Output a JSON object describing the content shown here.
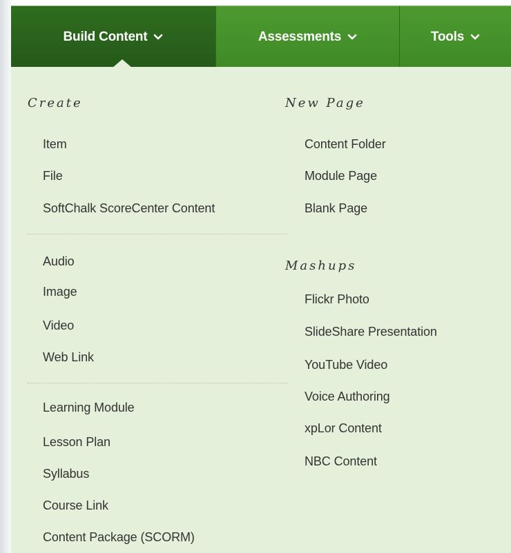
{
  "nav": {
    "tabs": [
      {
        "label": "Build Content",
        "active": true,
        "icon": "chevron-down-icon"
      },
      {
        "label": "Assessments",
        "active": false,
        "icon": "chevron-down-icon"
      },
      {
        "label": "Tools",
        "active": false,
        "icon": "chevron-down-icon"
      }
    ]
  },
  "menu": {
    "create": {
      "heading": "Create",
      "group1": [
        "Item",
        "File",
        "SoftChalk ScoreCenter Content"
      ],
      "group2": [
        "Audio",
        "Image",
        "Video",
        "Web Link"
      ],
      "group3": [
        "Learning Module",
        "Lesson Plan",
        "Syllabus",
        "Course Link",
        "Content Package (SCORM)"
      ]
    },
    "new_page": {
      "heading": "New Page",
      "items": [
        "Content Folder",
        "Module Page",
        "Blank Page"
      ]
    },
    "mashups": {
      "heading": "Mashups",
      "items": [
        "Flickr Photo",
        "SlideShare Presentation",
        "YouTube Video",
        "Voice Authoring",
        "xpLor Content",
        "NBC Content"
      ]
    }
  },
  "colors": {
    "nav_green": "#4d9a2f",
    "nav_active": "#2f6d1e",
    "panel_bg": "#e4f0da",
    "text": "#333333"
  }
}
